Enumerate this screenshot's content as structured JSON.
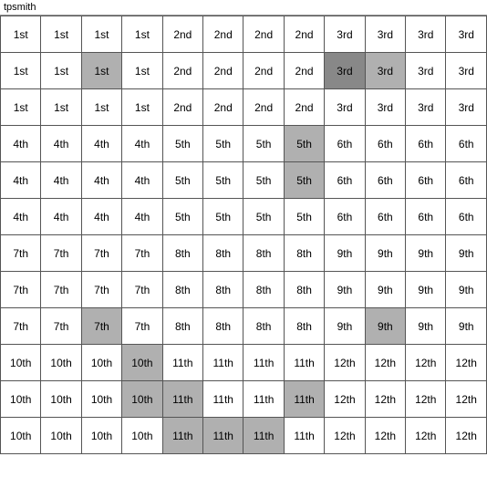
{
  "title": "tpsmith",
  "grid": {
    "rows": [
      [
        {
          "text": "1st",
          "bg": "normal"
        },
        {
          "text": "1st",
          "bg": "normal"
        },
        {
          "text": "1st",
          "bg": "normal"
        },
        {
          "text": "1st",
          "bg": "normal"
        },
        {
          "text": "2nd",
          "bg": "normal"
        },
        {
          "text": "2nd",
          "bg": "normal"
        },
        {
          "text": "2nd",
          "bg": "normal"
        },
        {
          "text": "2nd",
          "bg": "normal"
        },
        {
          "text": "3rd",
          "bg": "normal"
        },
        {
          "text": "3rd",
          "bg": "normal"
        },
        {
          "text": "3rd",
          "bg": "normal"
        },
        {
          "text": "3rd",
          "bg": "normal"
        }
      ],
      [
        {
          "text": "1st",
          "bg": "normal"
        },
        {
          "text": "1st",
          "bg": "normal"
        },
        {
          "text": "1st",
          "bg": "highlighted"
        },
        {
          "text": "1st",
          "bg": "normal"
        },
        {
          "text": "2nd",
          "bg": "normal"
        },
        {
          "text": "2nd",
          "bg": "normal"
        },
        {
          "text": "2nd",
          "bg": "normal"
        },
        {
          "text": "2nd",
          "bg": "normal"
        },
        {
          "text": "3rd",
          "bg": "dark-highlighted"
        },
        {
          "text": "3rd",
          "bg": "highlighted"
        },
        {
          "text": "3rd",
          "bg": "normal"
        },
        {
          "text": "3rd",
          "bg": "normal"
        }
      ],
      [
        {
          "text": "1st",
          "bg": "normal"
        },
        {
          "text": "1st",
          "bg": "normal"
        },
        {
          "text": "1st",
          "bg": "normal"
        },
        {
          "text": "1st",
          "bg": "normal"
        },
        {
          "text": "2nd",
          "bg": "normal"
        },
        {
          "text": "2nd",
          "bg": "normal"
        },
        {
          "text": "2nd",
          "bg": "normal"
        },
        {
          "text": "2nd",
          "bg": "normal"
        },
        {
          "text": "3rd",
          "bg": "normal"
        },
        {
          "text": "3rd",
          "bg": "normal"
        },
        {
          "text": "3rd",
          "bg": "normal"
        },
        {
          "text": "3rd",
          "bg": "normal"
        }
      ],
      [
        {
          "text": "4th",
          "bg": "normal"
        },
        {
          "text": "4th",
          "bg": "normal"
        },
        {
          "text": "4th",
          "bg": "normal"
        },
        {
          "text": "4th",
          "bg": "normal"
        },
        {
          "text": "5th",
          "bg": "normal"
        },
        {
          "text": "5th",
          "bg": "normal"
        },
        {
          "text": "5th",
          "bg": "normal"
        },
        {
          "text": "5th",
          "bg": "highlighted"
        },
        {
          "text": "6th",
          "bg": "normal"
        },
        {
          "text": "6th",
          "bg": "normal"
        },
        {
          "text": "6th",
          "bg": "normal"
        },
        {
          "text": "6th",
          "bg": "normal"
        }
      ],
      [
        {
          "text": "4th",
          "bg": "normal"
        },
        {
          "text": "4th",
          "bg": "normal"
        },
        {
          "text": "4th",
          "bg": "normal"
        },
        {
          "text": "4th",
          "bg": "normal"
        },
        {
          "text": "5th",
          "bg": "normal"
        },
        {
          "text": "5th",
          "bg": "normal"
        },
        {
          "text": "5th",
          "bg": "normal"
        },
        {
          "text": "5th",
          "bg": "highlighted"
        },
        {
          "text": "6th",
          "bg": "normal"
        },
        {
          "text": "6th",
          "bg": "normal"
        },
        {
          "text": "6th",
          "bg": "normal"
        },
        {
          "text": "6th",
          "bg": "normal"
        }
      ],
      [
        {
          "text": "4th",
          "bg": "normal"
        },
        {
          "text": "4th",
          "bg": "normal"
        },
        {
          "text": "4th",
          "bg": "normal"
        },
        {
          "text": "4th",
          "bg": "normal"
        },
        {
          "text": "5th",
          "bg": "normal"
        },
        {
          "text": "5th",
          "bg": "normal"
        },
        {
          "text": "5th",
          "bg": "normal"
        },
        {
          "text": "5th",
          "bg": "normal"
        },
        {
          "text": "6th",
          "bg": "normal"
        },
        {
          "text": "6th",
          "bg": "normal"
        },
        {
          "text": "6th",
          "bg": "normal"
        },
        {
          "text": "6th",
          "bg": "normal"
        }
      ],
      [
        {
          "text": "7th",
          "bg": "normal"
        },
        {
          "text": "7th",
          "bg": "normal"
        },
        {
          "text": "7th",
          "bg": "normal"
        },
        {
          "text": "7th",
          "bg": "normal"
        },
        {
          "text": "8th",
          "bg": "normal"
        },
        {
          "text": "8th",
          "bg": "normal"
        },
        {
          "text": "8th",
          "bg": "normal"
        },
        {
          "text": "8th",
          "bg": "normal"
        },
        {
          "text": "9th",
          "bg": "normal"
        },
        {
          "text": "9th",
          "bg": "normal"
        },
        {
          "text": "9th",
          "bg": "normal"
        },
        {
          "text": "9th",
          "bg": "normal"
        }
      ],
      [
        {
          "text": "7th",
          "bg": "normal"
        },
        {
          "text": "7th",
          "bg": "normal"
        },
        {
          "text": "7th",
          "bg": "normal"
        },
        {
          "text": "7th",
          "bg": "normal"
        },
        {
          "text": "8th",
          "bg": "normal"
        },
        {
          "text": "8th",
          "bg": "normal"
        },
        {
          "text": "8th",
          "bg": "normal"
        },
        {
          "text": "8th",
          "bg": "normal"
        },
        {
          "text": "9th",
          "bg": "normal"
        },
        {
          "text": "9th",
          "bg": "normal"
        },
        {
          "text": "9th",
          "bg": "normal"
        },
        {
          "text": "9th",
          "bg": "normal"
        }
      ],
      [
        {
          "text": "7th",
          "bg": "normal"
        },
        {
          "text": "7th",
          "bg": "normal"
        },
        {
          "text": "7th",
          "bg": "highlighted"
        },
        {
          "text": "7th",
          "bg": "normal"
        },
        {
          "text": "8th",
          "bg": "normal"
        },
        {
          "text": "8th",
          "bg": "normal"
        },
        {
          "text": "8th",
          "bg": "normal"
        },
        {
          "text": "8th",
          "bg": "normal"
        },
        {
          "text": "9th",
          "bg": "normal"
        },
        {
          "text": "9th",
          "bg": "highlighted"
        },
        {
          "text": "9th",
          "bg": "normal"
        },
        {
          "text": "9th",
          "bg": "normal"
        }
      ],
      [
        {
          "text": "10th",
          "bg": "normal"
        },
        {
          "text": "10th",
          "bg": "normal"
        },
        {
          "text": "10th",
          "bg": "normal"
        },
        {
          "text": "10th",
          "bg": "highlighted"
        },
        {
          "text": "11th",
          "bg": "normal"
        },
        {
          "text": "11th",
          "bg": "normal"
        },
        {
          "text": "11th",
          "bg": "normal"
        },
        {
          "text": "11th",
          "bg": "normal"
        },
        {
          "text": "12th",
          "bg": "normal"
        },
        {
          "text": "12th",
          "bg": "normal"
        },
        {
          "text": "12th",
          "bg": "normal"
        },
        {
          "text": "12th",
          "bg": "normal"
        }
      ],
      [
        {
          "text": "10th",
          "bg": "normal"
        },
        {
          "text": "10th",
          "bg": "normal"
        },
        {
          "text": "10th",
          "bg": "normal"
        },
        {
          "text": "10th",
          "bg": "highlighted"
        },
        {
          "text": "11th",
          "bg": "highlighted"
        },
        {
          "text": "11th",
          "bg": "normal"
        },
        {
          "text": "11th",
          "bg": "normal"
        },
        {
          "text": "11th",
          "bg": "highlighted"
        },
        {
          "text": "12th",
          "bg": "normal"
        },
        {
          "text": "12th",
          "bg": "normal"
        },
        {
          "text": "12th",
          "bg": "normal"
        },
        {
          "text": "12th",
          "bg": "normal"
        }
      ],
      [
        {
          "text": "10th",
          "bg": "normal"
        },
        {
          "text": "10th",
          "bg": "normal"
        },
        {
          "text": "10th",
          "bg": "normal"
        },
        {
          "text": "10th",
          "bg": "normal"
        },
        {
          "text": "11th",
          "bg": "highlighted"
        },
        {
          "text": "11th",
          "bg": "highlighted"
        },
        {
          "text": "11th",
          "bg": "highlighted"
        },
        {
          "text": "11th",
          "bg": "normal"
        },
        {
          "text": "12th",
          "bg": "normal"
        },
        {
          "text": "12th",
          "bg": "normal"
        },
        {
          "text": "12th",
          "bg": "normal"
        },
        {
          "text": "12th",
          "bg": "normal"
        }
      ]
    ]
  }
}
